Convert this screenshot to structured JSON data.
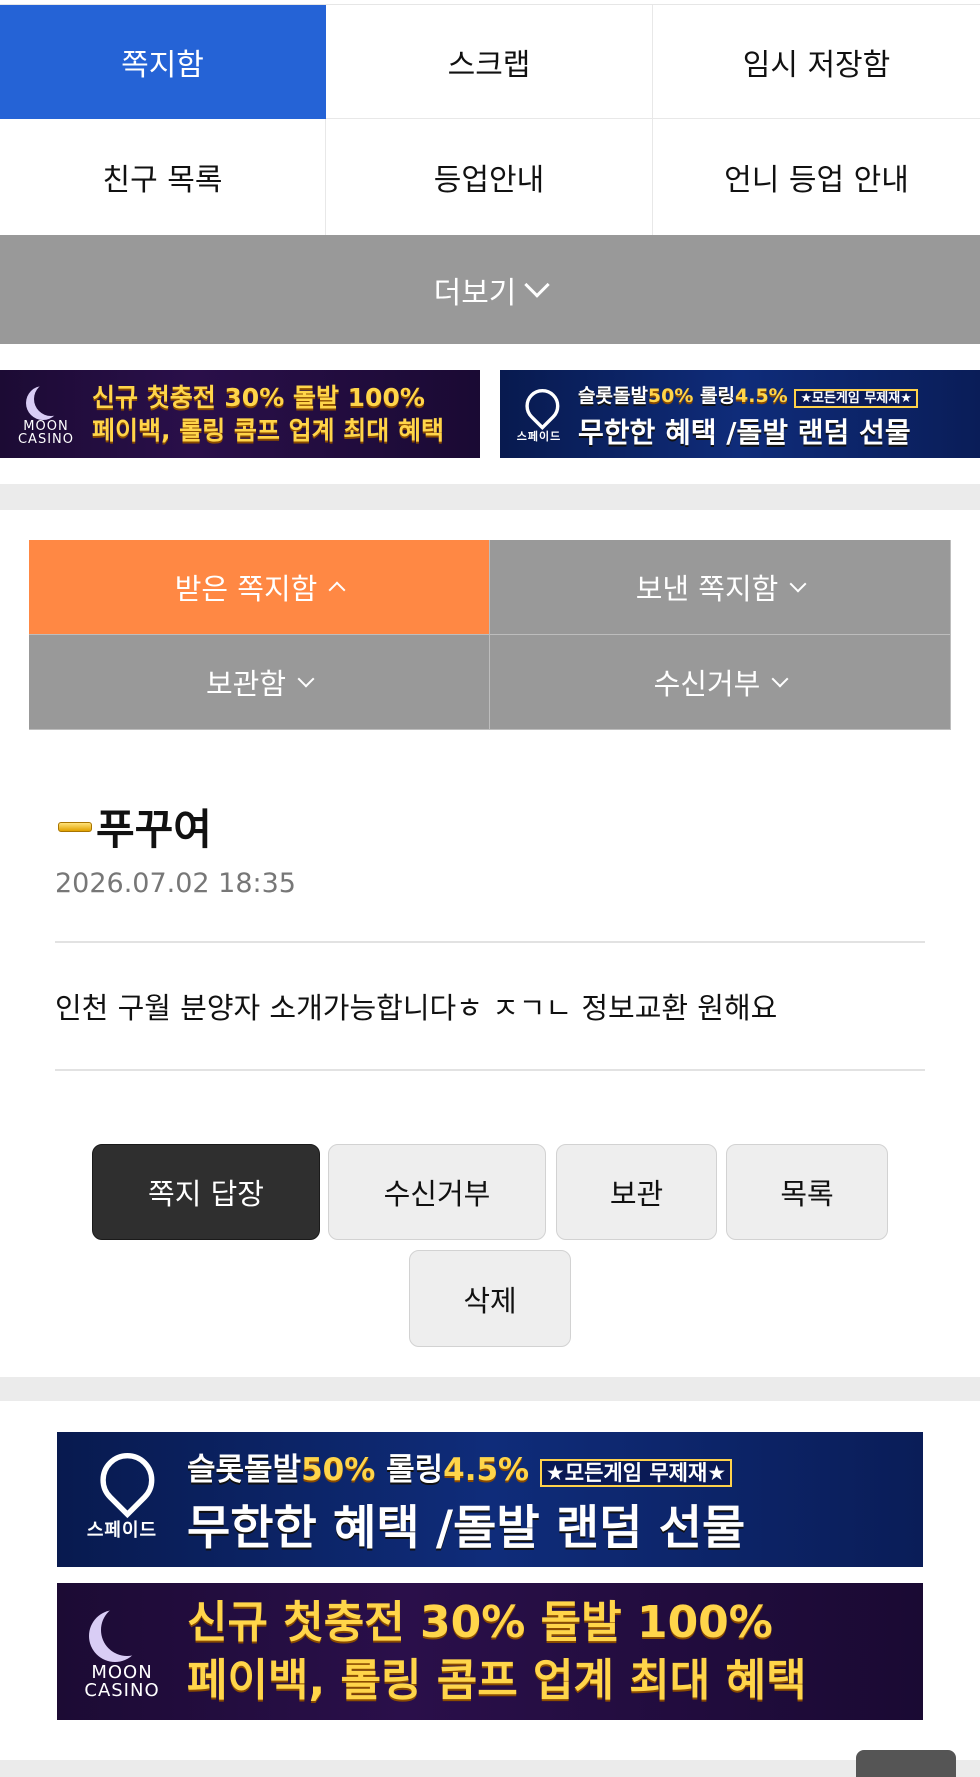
{
  "top_menu": [
    {
      "label": "쪽지함",
      "active": true
    },
    {
      "label": "스크랩",
      "active": false
    },
    {
      "label": "임시 저장함",
      "active": false
    },
    {
      "label": "친구 목록",
      "active": false
    },
    {
      "label": "등업안내",
      "active": false
    },
    {
      "label": "언니 등업 안내",
      "active": false
    }
  ],
  "more_label": "더보기",
  "banners": {
    "moon": {
      "logo": [
        "MOON",
        "CASINO"
      ],
      "line1": "신규 첫충전 30% 돌발 100%",
      "line2": "페이백, 롤링 콤프 업계 최대 혜택"
    },
    "spade": {
      "logo": "스페이드",
      "line1_a": "슬롯돌발",
      "line1_b": "50%",
      "line1_c": "롤링",
      "line1_d": "4.5%",
      "tag": "★모든게임 무제재★",
      "line2": "무한한 혜택 /돌발 랜덤 선물"
    }
  },
  "msg_tabs": [
    {
      "label": "받은 쪽지함",
      "active": true
    },
    {
      "label": "보낸 쪽지함",
      "active": false
    },
    {
      "label": "보관함",
      "active": false
    },
    {
      "label": "수신거부",
      "active": false
    }
  ],
  "message": {
    "sender": "푸꾸여",
    "date": "2026.07.02 18:35",
    "body": "인천 구월 분양자 소개가능합니다ㅎ ㅈㄱㄴ 정보교환 원해요"
  },
  "actions": {
    "reply": "쪽지 답장",
    "block": "수신거부",
    "keep": "보관",
    "list": "목록",
    "delete": "삭제"
  },
  "colors": {
    "active_tab": "#2563d6",
    "msg_tab_active": "#ff8844",
    "tab_gray": "#999999"
  }
}
